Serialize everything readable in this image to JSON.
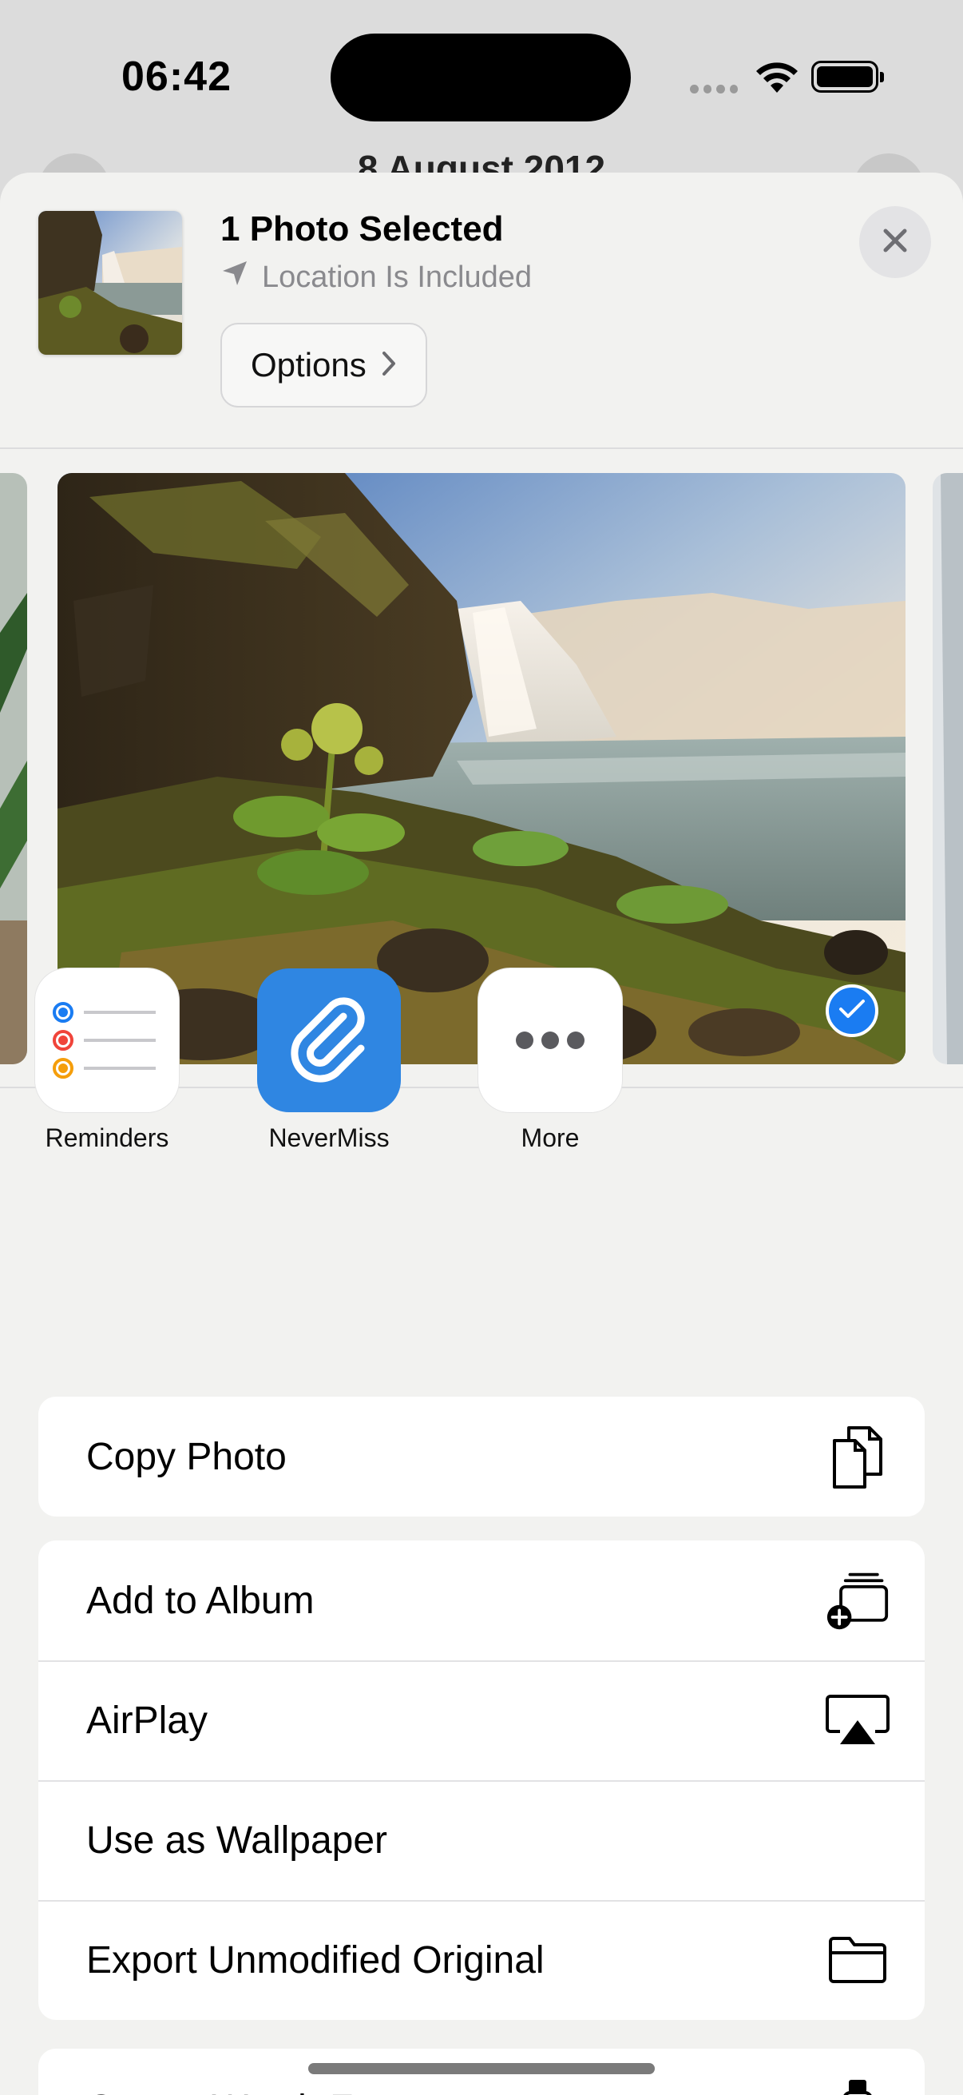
{
  "status_bar": {
    "time": "06:42"
  },
  "background": {
    "date_title": "8 August 2012"
  },
  "share_sheet": {
    "title": "1 Photo Selected",
    "location_note": "Location Is Included",
    "options_label": "Options",
    "icons": {
      "close": "close-icon",
      "location": "location-arrow-icon",
      "options_chevron": "chevron-right-icon",
      "selected": "checkmark-icon"
    }
  },
  "apps": [
    {
      "label": "Reminders",
      "icon": "reminders-icon"
    },
    {
      "label": "NeverMiss",
      "icon": "paperclip-icon"
    },
    {
      "label": "More",
      "icon": "more-icon"
    }
  ],
  "actions": {
    "copy_photo": "Copy Photo",
    "add_to_album": "Add to Album",
    "airplay": "AirPlay",
    "use_as_wallpaper": "Use as Wallpaper",
    "export_original": "Export Unmodified Original",
    "partial_next": "Create Watch Face"
  },
  "colors": {
    "accent_blue": "#1a7cf2",
    "nevermiss_tile": "#2f86e2",
    "reminders_blue": "#1a7cf2",
    "reminders_red": "#f0443a",
    "reminders_orange": "#f59e0b",
    "sheet_background": "#f2f2f0"
  }
}
